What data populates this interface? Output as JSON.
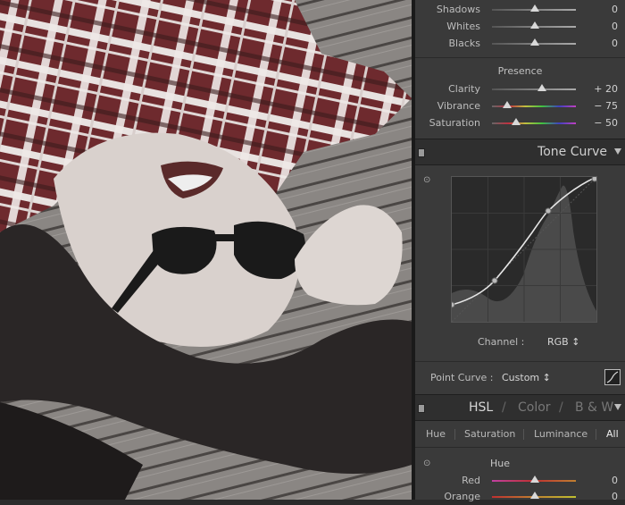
{
  "basic": {
    "rows": [
      {
        "label": "Shadows",
        "value": "0"
      },
      {
        "label": "Whites",
        "value": "0"
      },
      {
        "label": "Blacks",
        "value": "0"
      }
    ]
  },
  "presence": {
    "title": "Presence",
    "rows": [
      {
        "label": "Clarity",
        "value": "+ 20"
      },
      {
        "label": "Vibrance",
        "value": "− 75"
      },
      {
        "label": "Saturation",
        "value": "− 50"
      }
    ]
  },
  "tone_curve": {
    "title": "Tone Curve",
    "channel_label": "Channel :",
    "channel_value": "RGB ↕",
    "point_curve_label": "Point Curve :",
    "point_curve_value": "Custom ↕"
  },
  "hsl": {
    "tab_hsl": "HSL",
    "sep1": "/",
    "tab_color": "Color",
    "sep2": "/",
    "tab_bw": "B & W",
    "subtabs": [
      "Hue",
      "Saturation",
      "Luminance",
      "All"
    ],
    "group_title": "Hue",
    "rows": [
      {
        "label": "Red",
        "value": "0"
      },
      {
        "label": "Orange",
        "value": "0"
      }
    ]
  }
}
